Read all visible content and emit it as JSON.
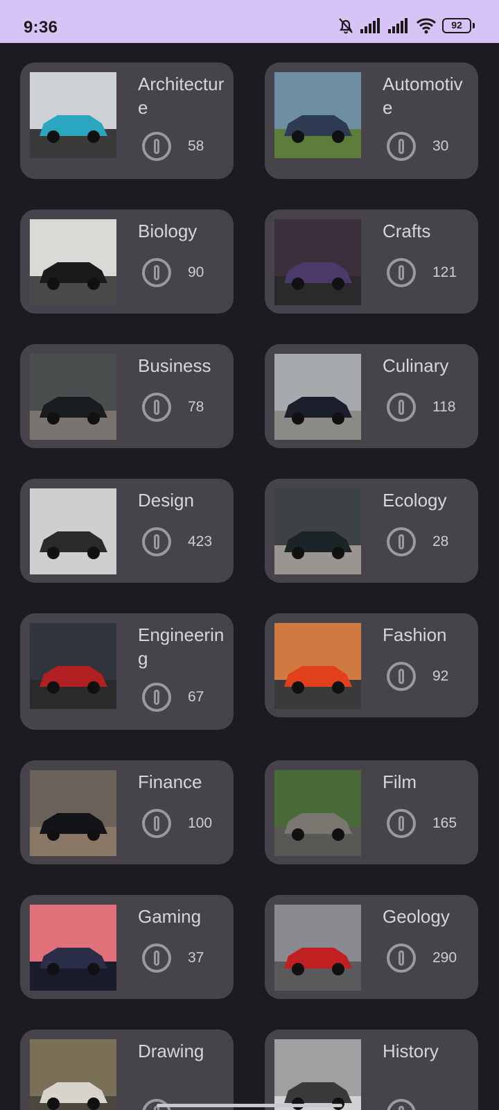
{
  "status_bar": {
    "time": "9:36",
    "battery": "92",
    "icons": [
      "bell-off-icon",
      "signal-icon",
      "signal-icon",
      "wifi-icon",
      "battery-icon"
    ]
  },
  "categories": [
    {
      "title": "Architecture",
      "count": "58",
      "icon": "info-icon",
      "image": "car-photo"
    },
    {
      "title": "Automotive",
      "count": "30",
      "icon": "info-icon",
      "image": "car-photo"
    },
    {
      "title": "Biology",
      "count": "90",
      "icon": "info-icon",
      "image": "car-photo"
    },
    {
      "title": "Crafts",
      "count": "121",
      "icon": "info-icon",
      "image": "car-photo"
    },
    {
      "title": "Business",
      "count": "78",
      "icon": "info-icon",
      "image": "car-photo"
    },
    {
      "title": "Culinary",
      "count": "118",
      "icon": "info-icon",
      "image": "car-photo"
    },
    {
      "title": "Design",
      "count": "423",
      "icon": "info-icon",
      "image": "car-photo"
    },
    {
      "title": "Ecology",
      "count": "28",
      "icon": "info-icon",
      "image": "car-photo"
    },
    {
      "title": "Engineering",
      "count": "67",
      "icon": "info-icon",
      "image": "car-photo"
    },
    {
      "title": "Fashion",
      "count": "92",
      "icon": "info-icon",
      "image": "car-photo"
    },
    {
      "title": "Finance",
      "count": "100",
      "icon": "info-icon",
      "image": "car-photo"
    },
    {
      "title": "Film",
      "count": "165",
      "icon": "info-icon",
      "image": "car-photo"
    },
    {
      "title": "Gaming",
      "count": "37",
      "icon": "info-icon",
      "image": "car-photo"
    },
    {
      "title": "Geology",
      "count": "290",
      "icon": "info-icon",
      "image": "car-photo"
    },
    {
      "title": "Drawing",
      "count": "",
      "icon": "info-icon",
      "image": "car-photo"
    },
    {
      "title": "History",
      "count": "",
      "icon": "info-icon",
      "image": "car-photo"
    }
  ],
  "colors": {
    "status_bar_bg": "#d6c4f7",
    "background": "#1c1b20",
    "card_bg": "#46434b",
    "text": "#d8d4dc",
    "icon": "#9c98a2"
  }
}
